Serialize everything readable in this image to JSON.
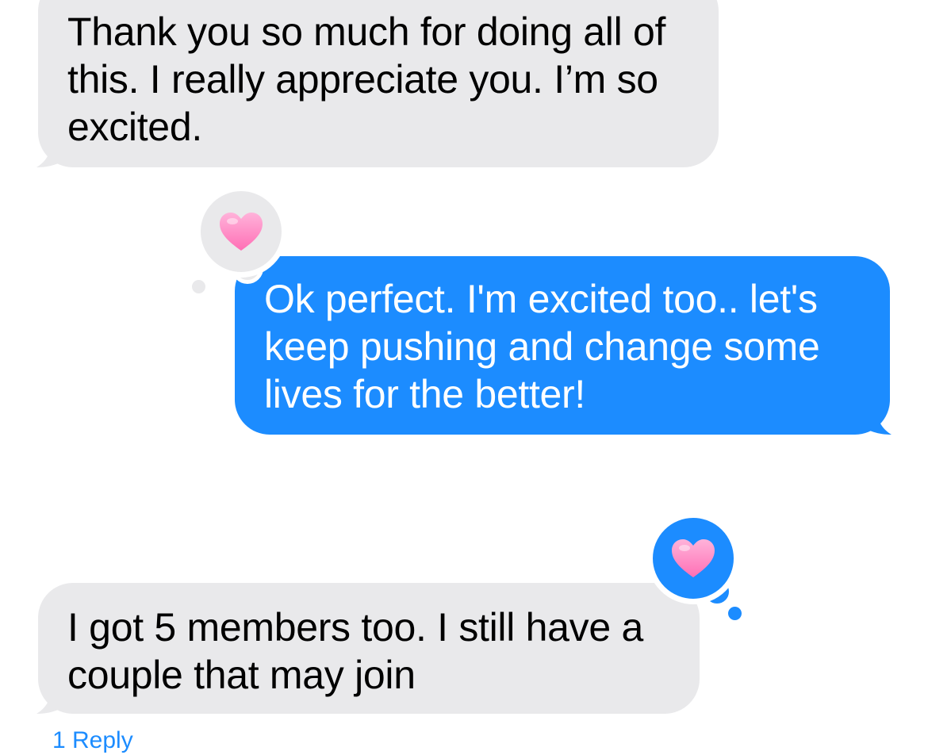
{
  "messages": [
    {
      "direction": "received",
      "text": "Thank you so much for doing all of this. I really appreciate you. I’m so excited."
    },
    {
      "direction": "sent",
      "text": "Ok perfect. I'm excited too.. let's keep pushing and change some lives for the better!",
      "tapback": {
        "icon": "heart-icon",
        "color": "#ff8fc4",
        "bubble_color": "#e9e9eb"
      }
    },
    {
      "direction": "received",
      "text": "I got 5 members too. I still have a couple that may join",
      "tapback": {
        "icon": "heart-icon",
        "color": "#ff8fc4",
        "bubble_color": "#1c8cff"
      }
    }
  ],
  "thread": {
    "reply_link": "1 Reply"
  },
  "colors": {
    "sent_bubble": "#1c8cff",
    "received_bubble": "#e9e9eb",
    "link": "#1c8cff",
    "heart": "#ff8fc4"
  }
}
